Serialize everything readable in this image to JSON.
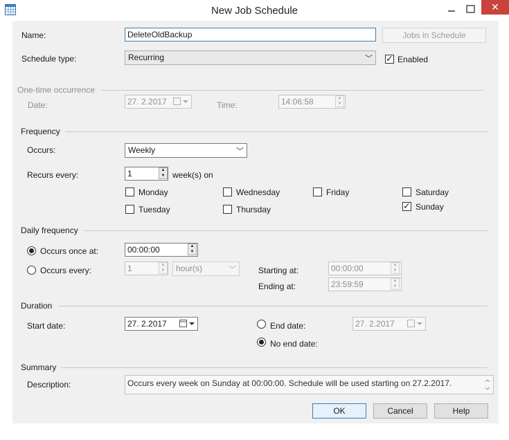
{
  "window": {
    "title": "New Job Schedule",
    "icons": {
      "app": "calendar-grid-icon",
      "minimize": "minimize-icon",
      "maximize": "maximize-icon",
      "close": "close-icon"
    },
    "close_glyph": "✕"
  },
  "name": {
    "label": "Name:",
    "value": "DeleteOldBackup",
    "jobs_button": "Jobs in Schedule"
  },
  "schedule_type": {
    "label": "Schedule type:",
    "value": "Recurring",
    "enabled_label": "Enabled",
    "enabled": true
  },
  "one_time": {
    "header": "One-time occurrence",
    "date_label": "Date:",
    "date_value": "27. 2.2017",
    "time_label": "Time:",
    "time_value": "14:06:58"
  },
  "frequency": {
    "header": "Frequency",
    "occurs_label": "Occurs:",
    "occurs_value": "Weekly",
    "recurs_label": "Recurs every:",
    "recurs_value": "1",
    "recurs_unit": "week(s) on",
    "days": [
      {
        "label": "Monday",
        "checked": false
      },
      {
        "label": "Wednesday",
        "checked": false
      },
      {
        "label": "Friday",
        "checked": false
      },
      {
        "label": "Saturday",
        "checked": false
      },
      {
        "label": "Tuesday",
        "checked": false
      },
      {
        "label": "Thursday",
        "checked": false
      },
      {
        "label": "Sunday",
        "checked": true
      }
    ]
  },
  "daily": {
    "header": "Daily frequency",
    "once_label": "Occurs once at:",
    "once_value": "00:00:00",
    "every_label": "Occurs every:",
    "every_value": "1",
    "every_unit": "hour(s)",
    "starting_label": "Starting at:",
    "starting_value": "00:00:00",
    "ending_label": "Ending at:",
    "ending_value": "23:59:59",
    "mode": "once"
  },
  "duration": {
    "header": "Duration",
    "start_label": "Start date:",
    "start_value": "27. 2.2017",
    "end_label": "End date:",
    "end_value": "27. 2.2017",
    "no_end_label": "No end date:",
    "mode": "no_end"
  },
  "summary": {
    "header": "Summary",
    "desc_label": "Description:",
    "desc_value": "Occurs every week on Sunday at 00:00:00. Schedule will be used starting on 27.2.2017."
  },
  "buttons": {
    "ok": "OK",
    "cancel": "Cancel",
    "help": "Help"
  }
}
